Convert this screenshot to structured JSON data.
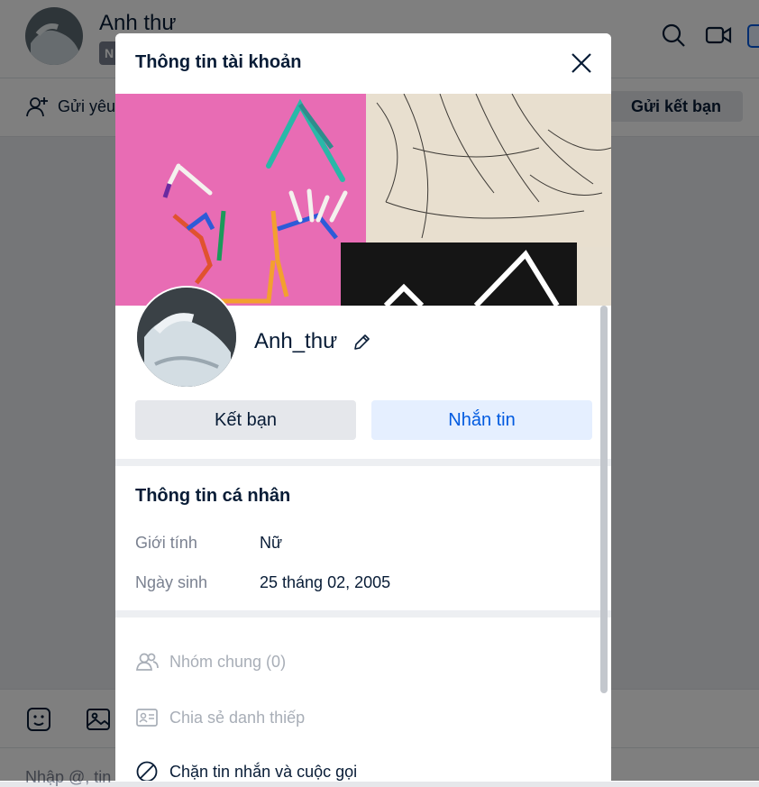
{
  "background": {
    "chat_name": "Anh thư",
    "tag": "N",
    "send_request_label": "Gửi yêu",
    "add_friend_label": "Gửi kết bạn",
    "input_placeholder": "Nhập @, tin"
  },
  "modal": {
    "title": "Thông tin tài khoản",
    "name": "Anh_thư",
    "add_friend_button": "Kết bạn",
    "message_button": "Nhắn tin",
    "personal_info": {
      "title": "Thông tin cá nhân",
      "gender_label": "Giới tính",
      "gender_value": "Nữ",
      "birthday_label": "Ngày sinh",
      "birthday_value": "25 tháng 02, 2005"
    },
    "actions": {
      "mutual_groups": "Nhóm chung (0)",
      "share_card": "Chia sẻ danh thiếp",
      "block": "Chặn tin nhắn và cuộc gọi"
    }
  },
  "colors": {
    "accent": "#005ae0",
    "accent_bg": "#e5efff",
    "text_primary": "#081c36",
    "text_muted": "#7a8190"
  }
}
